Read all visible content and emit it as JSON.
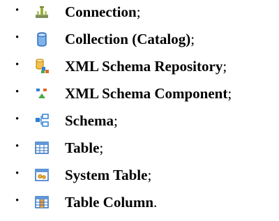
{
  "items": [
    {
      "label": "Connection",
      "punct": ";",
      "icon": "connection-icon"
    },
    {
      "label": "Collection (Catalog)",
      "punct": ";",
      "icon": "collection-icon"
    },
    {
      "label": "XML Schema Repository",
      "punct": ";",
      "icon": "xml-schema-repository-icon"
    },
    {
      "label": "XML Schema Component",
      "punct": ";",
      "icon": "xml-schema-component-icon"
    },
    {
      "label": "Schema",
      "punct": ";",
      "icon": "schema-icon"
    },
    {
      "label": "Table",
      "punct": ";",
      "icon": "table-icon"
    },
    {
      "label": "System Table",
      "punct": ";",
      "icon": "system-table-icon"
    },
    {
      "label": "Table Column",
      "punct": ".",
      "icon": "table-column-icon"
    }
  ],
  "bullet": "•"
}
